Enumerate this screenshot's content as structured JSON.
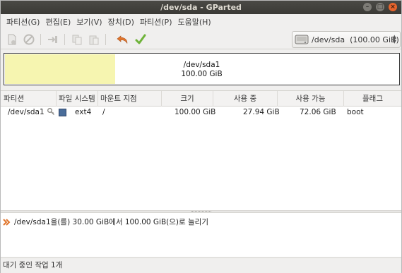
{
  "window": {
    "title": "/dev/sda - GParted"
  },
  "menubar": {
    "items": [
      "파티션(G)",
      "편집(E)",
      "보기(V)",
      "장치(D)",
      "파티션(P)",
      "도움말(H)"
    ]
  },
  "toolbar": {
    "buttons": [
      {
        "icon": "new-partition-icon",
        "enabled": false
      },
      {
        "icon": "delete-icon",
        "enabled": false
      },
      {
        "icon": "resize-move-icon",
        "enabled": false
      },
      {
        "icon": "copy-icon",
        "enabled": false
      },
      {
        "icon": "paste-icon",
        "enabled": false
      },
      {
        "icon": "undo-icon",
        "enabled": true,
        "color": "#e0752c"
      },
      {
        "icon": "apply-icon",
        "enabled": true,
        "color": "#6fb33a"
      }
    ],
    "device": {
      "name": "/dev/sda",
      "size": "(100.00 GiB)"
    }
  },
  "graphic": {
    "partition": "/dev/sda1",
    "size": "100.00 GiB",
    "used_fraction": 0.2794,
    "used_color": "#f6f5b0"
  },
  "table": {
    "columns": [
      "파티션",
      "파일 시스템",
      "마운트 지점",
      "크기",
      "사용 중",
      "사용 가능",
      "플래그"
    ],
    "rows": [
      {
        "partition": "/dev/sda1",
        "fs_color": "#4a6d9a",
        "filesystem": "ext4",
        "mount": "/",
        "size": "100.00 GiB",
        "used": "27.94 GiB",
        "unused": "72.06 GiB",
        "flags": "boot"
      }
    ]
  },
  "operations": {
    "items": [
      "/dev/sda1을(를) 30.00 GiB에서 100.00 GiB(으)로 늘리기"
    ]
  },
  "status": {
    "text": "대기 중인 작업 1개"
  }
}
